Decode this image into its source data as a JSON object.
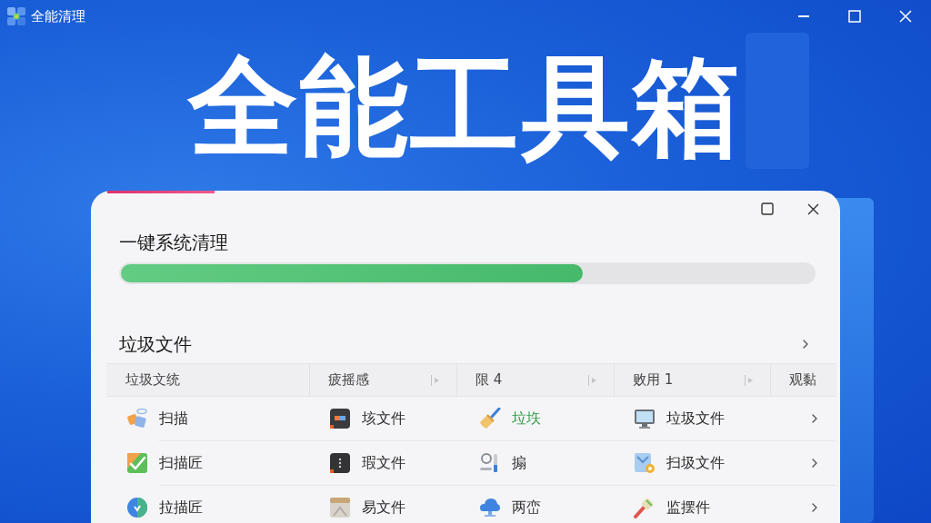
{
  "window": {
    "title": "全能清理"
  },
  "hero": {
    "title": "全能工具箱"
  },
  "dialog": {
    "title": "一键系统清理",
    "progress": {
      "level": 0.667
    },
    "section": {
      "title": "垃圾文件"
    },
    "table": {
      "columns": [
        {
          "label": "垃圾文统",
          "sortable": false
        },
        {
          "label": "疲摇感",
          "sortable": true
        },
        {
          "label": "限 4",
          "sortable": true
        },
        {
          "label": "败用 1",
          "sortable": true
        },
        {
          "label": "观黏",
          "sortable": false
        }
      ],
      "rows": [
        {
          "cells": [
            {
              "label": "扫描",
              "highlighted": false
            },
            {
              "label": "垓文件",
              "highlighted": false
            },
            {
              "label": "垃垁",
              "highlighted": true
            },
            {
              "label": "垃圾文件",
              "highlighted": false
            }
          ]
        },
        {
          "cells": [
            {
              "label": "扫描匠",
              "highlighted": false
            },
            {
              "label": "瑕文件",
              "highlighted": false
            },
            {
              "label": "搧",
              "highlighted": false
            },
            {
              "label": "扫圾文件",
              "highlighted": false
            }
          ]
        },
        {
          "cells": [
            {
              "label": "拉描匠",
              "highlighted": false
            },
            {
              "label": "易文件",
              "highlighted": false
            },
            {
              "label": "两峦",
              "highlighted": false
            },
            {
              "label": "监摆件",
              "highlighted": false
            }
          ]
        }
      ]
    }
  }
}
